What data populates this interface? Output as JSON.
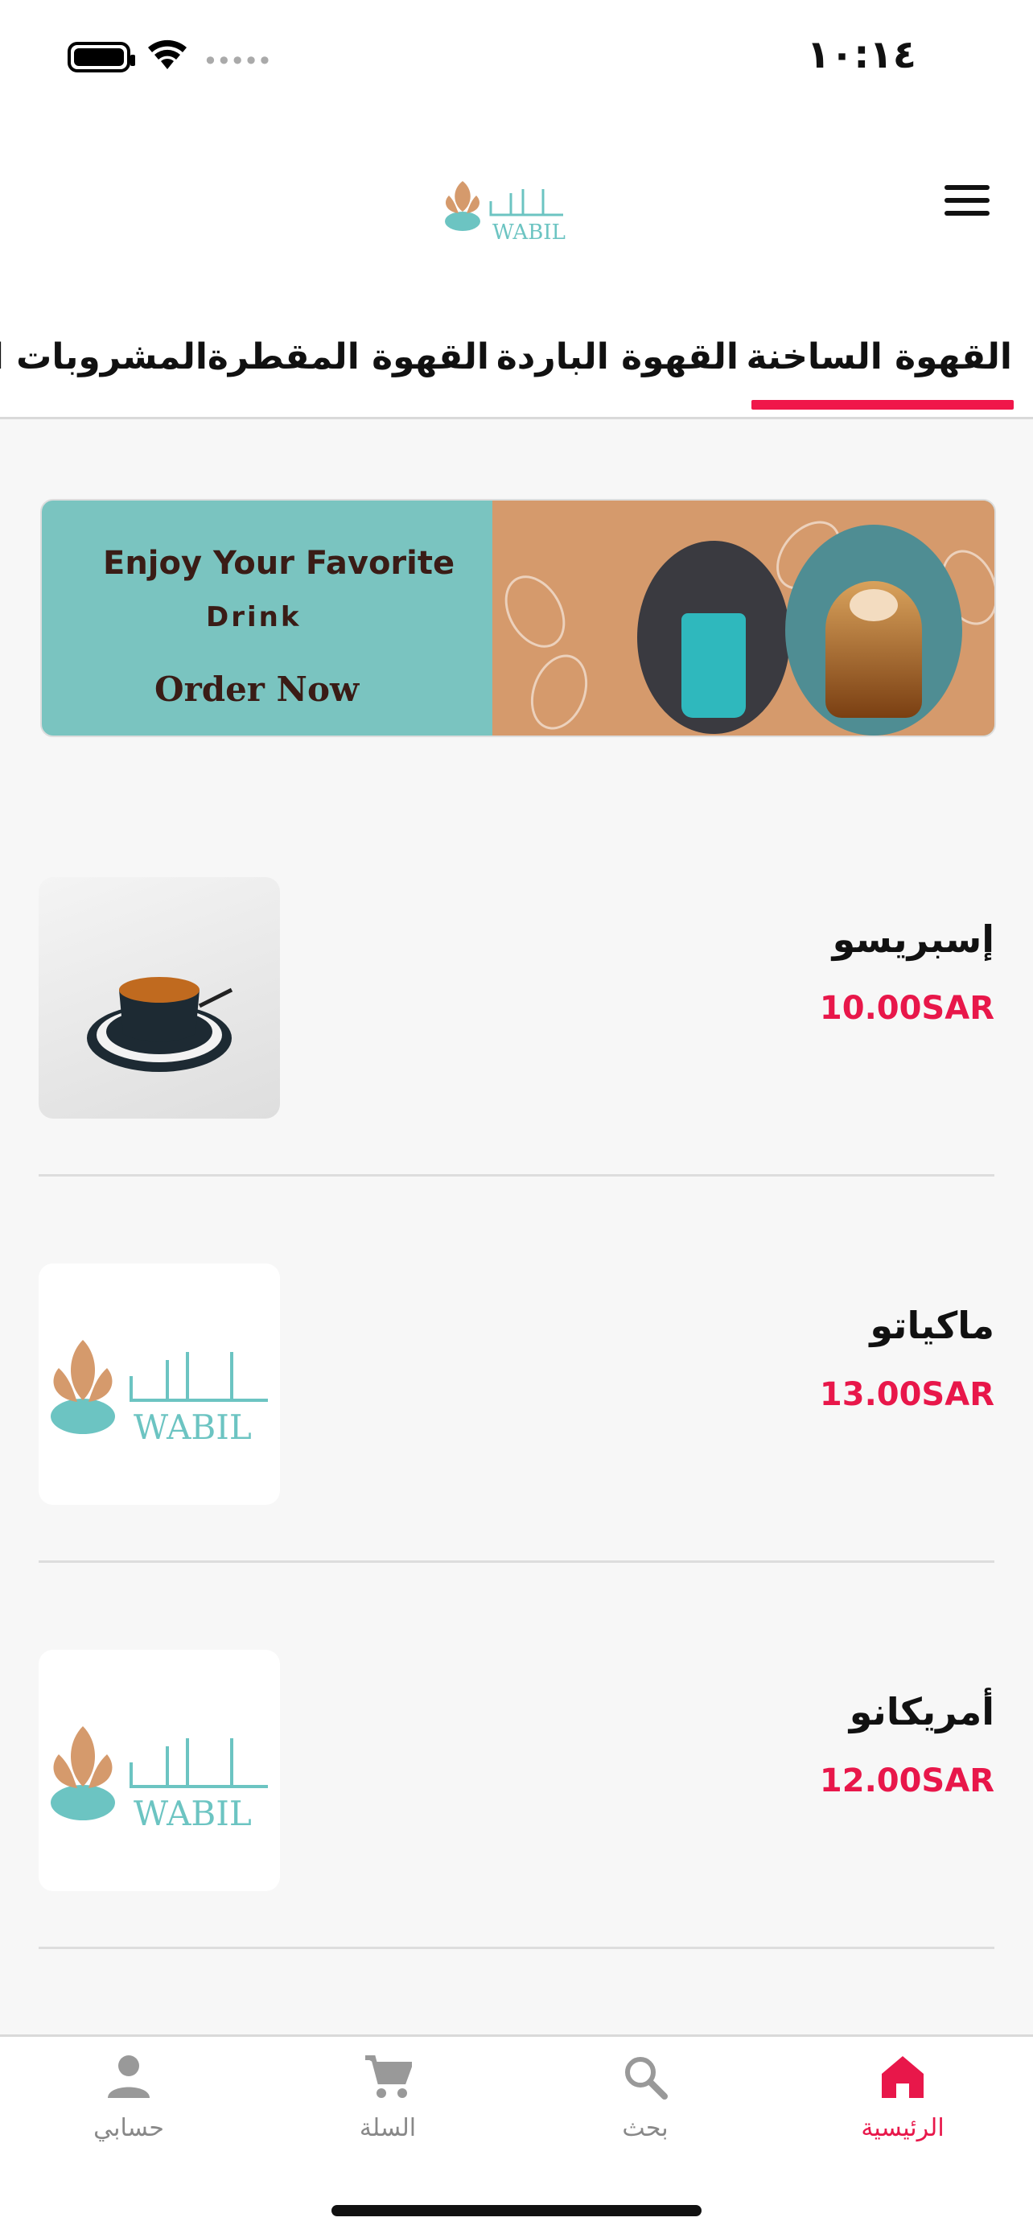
{
  "status_bar": {
    "time": "١٠:١٤"
  },
  "header": {
    "logo_text_ar": "وابل",
    "logo_text_en": "WABIL"
  },
  "tabs": [
    {
      "label": "القهوة الساخنة",
      "active": true
    },
    {
      "label": "القهوة الباردة",
      "active": false
    },
    {
      "label": "القهوة المقطرة",
      "active": false
    },
    {
      "label": "المشروبات ال",
      "active": false
    }
  ],
  "banner": {
    "line1": "Enjoy Your Favorite",
    "line2": "Drink",
    "cta": "Order Now"
  },
  "products": [
    {
      "name": "إسبريسو",
      "price": "10.00SAR",
      "image": "espresso-photo"
    },
    {
      "name": "ماكياتو",
      "price": "13.00SAR",
      "image": "wabil-logo"
    },
    {
      "name": "أمريكانو",
      "price": "12.00SAR",
      "image": "wabil-logo"
    }
  ],
  "bottom_nav": [
    {
      "label": "الرئيسية",
      "icon": "home-icon",
      "active": true
    },
    {
      "label": "بحث",
      "icon": "search-icon",
      "active": false
    },
    {
      "label": "السلة",
      "icon": "cart-icon",
      "active": false
    },
    {
      "label": "حسابي",
      "icon": "user-icon",
      "active": false
    }
  ],
  "colors": {
    "accent": "#e8174a",
    "teal": "#6cc4c2",
    "brown": "#d59a6c"
  }
}
